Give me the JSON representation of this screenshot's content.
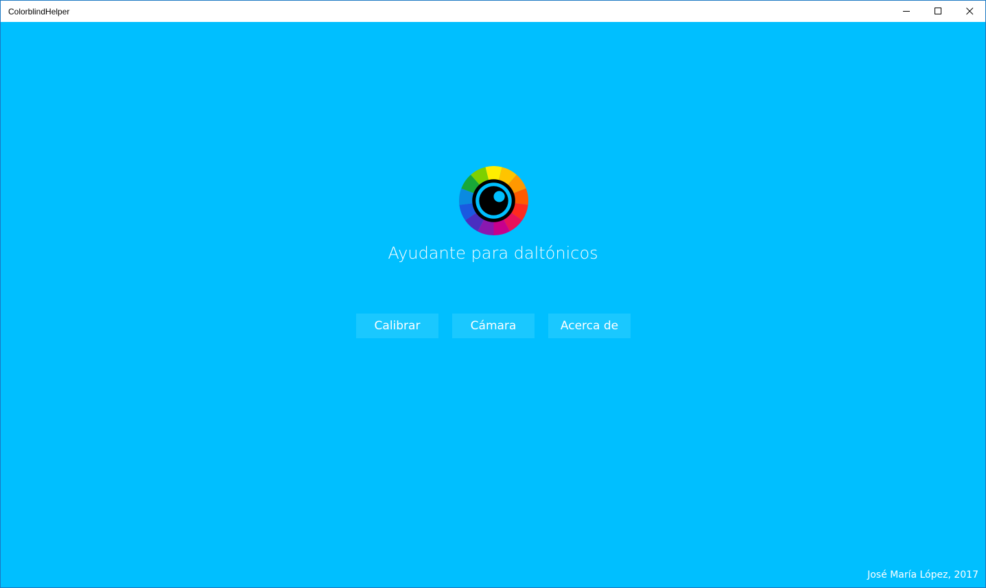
{
  "window": {
    "title": "ColorblindHelper",
    "controls": {
      "minimize_icon": "minimize-icon",
      "maximize_icon": "maximize-icon",
      "close_icon": "close-icon"
    }
  },
  "main": {
    "background_color": "#00bfff",
    "logo_icon": "color-wheel-eye-icon",
    "headline": "Ayudante para daltónicos",
    "buttons": [
      {
        "label": "Calibrar"
      },
      {
        "label": "Cámara"
      },
      {
        "label": "Acerca de"
      }
    ],
    "footer": "José María López, 2017"
  }
}
